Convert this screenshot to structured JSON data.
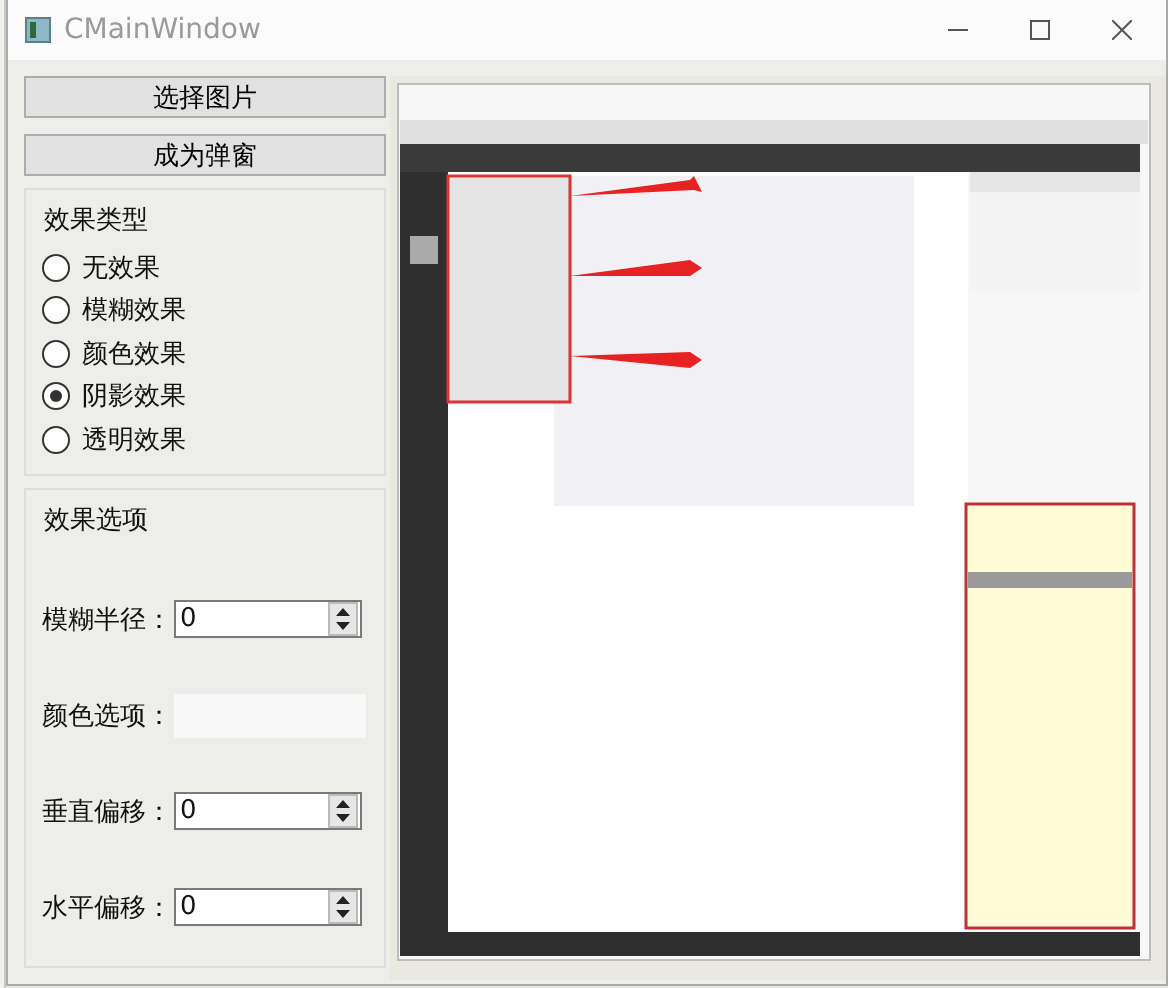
{
  "window": {
    "title": "CMainWindow"
  },
  "buttons": [
    {
      "label": "选择图片"
    },
    {
      "label": "成为弹窗"
    }
  ],
  "effect_type": {
    "title": "效果类型",
    "options": [
      {
        "label": "无效果",
        "selected": false
      },
      {
        "label": "模糊效果",
        "selected": false
      },
      {
        "label": "颜色效果",
        "selected": false
      },
      {
        "label": "阴影效果",
        "selected": true
      },
      {
        "label": "透明效果",
        "selected": false
      }
    ]
  },
  "effect_options": {
    "title": "效果选项",
    "fields": [
      {
        "kind": "spinbox",
        "label": "模糊半径：",
        "value": "0"
      },
      {
        "kind": "color",
        "label": "颜色选项："
      },
      {
        "kind": "spinbox",
        "label": "垂直偏移：",
        "value": "0"
      },
      {
        "kind": "spinbox",
        "label": "水平偏移：",
        "value": "0"
      }
    ]
  }
}
